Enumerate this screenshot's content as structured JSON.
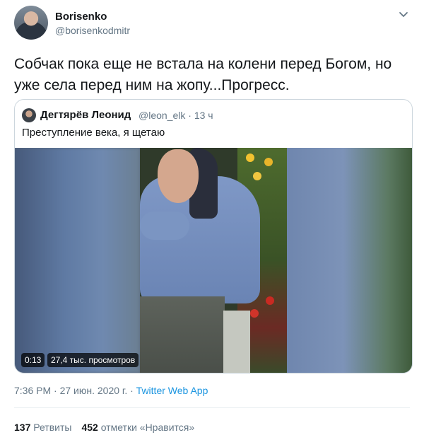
{
  "author": {
    "name": "Borisenko",
    "handle": "@borisenkodmitr"
  },
  "tweet": {
    "text": "Собчак пока еще не встала на колени перед Богом, но уже села перед ним на жопу...Прогресс."
  },
  "quoted": {
    "name": "Дегтярёв Леонид",
    "handle": "@leon_elk",
    "age": "· 13 ч",
    "text": "Преступление века, я щетаю",
    "video_duration": "0:13",
    "video_views": "27,4 тыс. просмотров"
  },
  "meta": {
    "time": "7:36 PM",
    "sep1": " · ",
    "date": "27 июн. 2020 г.",
    "sep2": " · ",
    "app": "Twitter Web App"
  },
  "stats": {
    "retweets_count": "137",
    "retweets_label": "Ретвиты",
    "likes_count": "452",
    "likes_label": "отметки «Нравится»"
  },
  "icons": {
    "menu": "chevron-down-icon"
  }
}
